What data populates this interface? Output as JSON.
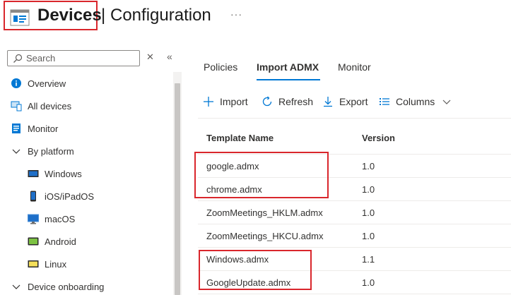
{
  "header": {
    "title": "Devices",
    "separator": "|",
    "subtitle": "Configuration",
    "more": "···",
    "icon": "devices-config-icon"
  },
  "sidebar": {
    "search_placeholder": "Search",
    "close_glyph": "✕",
    "collapse_glyph": "«",
    "items": [
      {
        "label": "Overview",
        "icon": "info-icon"
      },
      {
        "label": "All devices",
        "icon": "devices-icon"
      },
      {
        "label": "Monitor",
        "icon": "monitor-icon"
      },
      {
        "label": "By platform",
        "icon": "chevron-down-icon"
      },
      {
        "label": "Windows",
        "icon": "windows-icon"
      },
      {
        "label": "iOS/iPadOS",
        "icon": "ios-icon"
      },
      {
        "label": "macOS",
        "icon": "macos-icon"
      },
      {
        "label": "Android",
        "icon": "android-icon"
      },
      {
        "label": "Linux",
        "icon": "linux-icon"
      },
      {
        "label": "Device onboarding",
        "icon": "chevron-down-icon"
      }
    ]
  },
  "tabs": [
    {
      "label": "Policies",
      "active": false
    },
    {
      "label": "Import ADMX",
      "active": true
    },
    {
      "label": "Monitor",
      "active": false
    }
  ],
  "toolbar": {
    "import": "Import",
    "refresh": "Refresh",
    "export": "Export",
    "columns": "Columns"
  },
  "table": {
    "headers": [
      "Template Name",
      "Version"
    ],
    "rows": [
      {
        "name": "google.admx",
        "version": "1.0"
      },
      {
        "name": "chrome.admx",
        "version": "1.0"
      },
      {
        "name": "ZoomMeetings_HKLM.admx",
        "version": "1.0"
      },
      {
        "name": "ZoomMeetings_HKCU.admx",
        "version": "1.0"
      },
      {
        "name": "Windows.admx",
        "version": "1.1"
      },
      {
        "name": "GoogleUpdate.admx",
        "version": "1.0"
      }
    ]
  },
  "colors": {
    "accent": "#0078d4",
    "highlight": "#d9262c"
  }
}
